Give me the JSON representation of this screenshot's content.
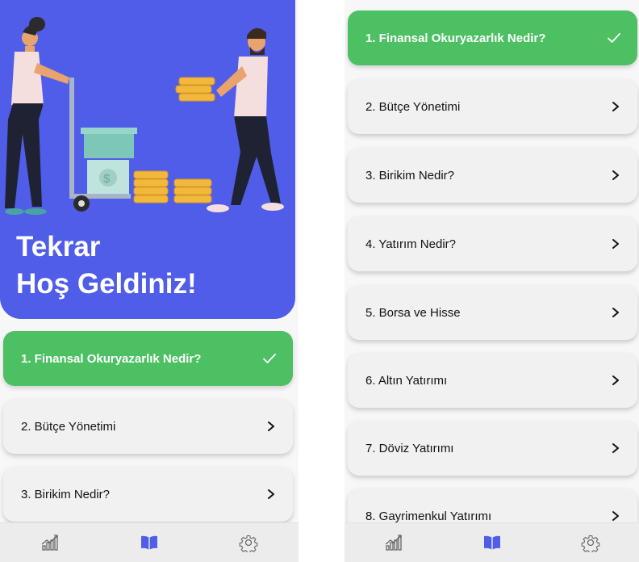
{
  "screens": {
    "home": {
      "title_line1": "Tekrar",
      "title_line2": "Hoş Geldiniz!"
    }
  },
  "lessons": [
    {
      "label": "1. Finansal Okuryazarlık Nedir?",
      "completed": true
    },
    {
      "label": "2. Bütçe Yönetimi",
      "completed": false
    },
    {
      "label": "3. Birikim Nedir?",
      "completed": false
    },
    {
      "label": "4. Yatırım Nedir?",
      "completed": false
    },
    {
      "label": "5. Borsa ve Hisse",
      "completed": false
    },
    {
      "label": "6. Altın Yatırımı",
      "completed": false
    },
    {
      "label": "7. Döviz Yatırımı",
      "completed": false
    },
    {
      "label": "8. Gayrimenkul Yatırımı",
      "completed": false
    }
  ],
  "nav": {
    "items": [
      {
        "icon": "chart-growth-icon",
        "active": false
      },
      {
        "icon": "book-icon",
        "active": true
      },
      {
        "icon": "gear-icon",
        "active": false
      }
    ]
  },
  "colors": {
    "hero": "#4f5de8",
    "completed": "#4cc063",
    "card": "#f1f1f1",
    "nav_active": "#4f5de8",
    "nav_inactive": "#666666"
  }
}
